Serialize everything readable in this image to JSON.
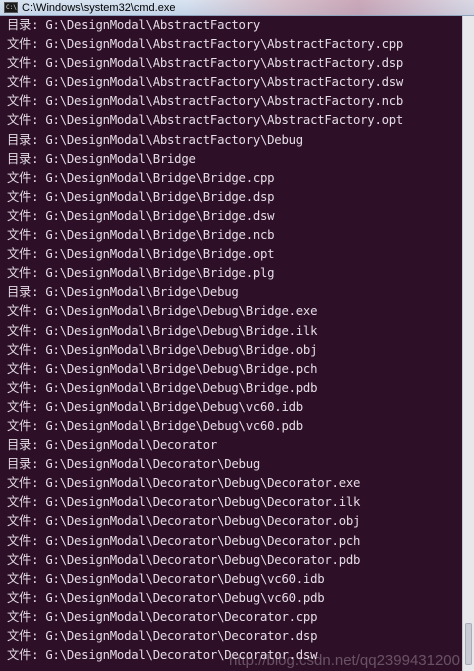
{
  "window": {
    "title": "C:\\Windows\\system32\\cmd.exe",
    "icon_name": "cmd-console-icon"
  },
  "console": {
    "background": "#2e0f28",
    "foreground": "#e4dce4",
    "lines": [
      "目录: G:\\DesignModal\\AbstractFactory",
      "文件: G:\\DesignModal\\AbstractFactory\\AbstractFactory.cpp",
      "文件: G:\\DesignModal\\AbstractFactory\\AbstractFactory.dsp",
      "文件: G:\\DesignModal\\AbstractFactory\\AbstractFactory.dsw",
      "文件: G:\\DesignModal\\AbstractFactory\\AbstractFactory.ncb",
      "文件: G:\\DesignModal\\AbstractFactory\\AbstractFactory.opt",
      "目录: G:\\DesignModal\\AbstractFactory\\Debug",
      "目录: G:\\DesignModal\\Bridge",
      "文件: G:\\DesignModal\\Bridge\\Bridge.cpp",
      "文件: G:\\DesignModal\\Bridge\\Bridge.dsp",
      "文件: G:\\DesignModal\\Bridge\\Bridge.dsw",
      "文件: G:\\DesignModal\\Bridge\\Bridge.ncb",
      "文件: G:\\DesignModal\\Bridge\\Bridge.opt",
      "文件: G:\\DesignModal\\Bridge\\Bridge.plg",
      "目录: G:\\DesignModal\\Bridge\\Debug",
      "文件: G:\\DesignModal\\Bridge\\Debug\\Bridge.exe",
      "文件: G:\\DesignModal\\Bridge\\Debug\\Bridge.ilk",
      "文件: G:\\DesignModal\\Bridge\\Debug\\Bridge.obj",
      "文件: G:\\DesignModal\\Bridge\\Debug\\Bridge.pch",
      "文件: G:\\DesignModal\\Bridge\\Debug\\Bridge.pdb",
      "文件: G:\\DesignModal\\Bridge\\Debug\\vc60.idb",
      "文件: G:\\DesignModal\\Bridge\\Debug\\vc60.pdb",
      "目录: G:\\DesignModal\\Decorator",
      "目录: G:\\DesignModal\\Decorator\\Debug",
      "文件: G:\\DesignModal\\Decorator\\Debug\\Decorator.exe",
      "文件: G:\\DesignModal\\Decorator\\Debug\\Decorator.ilk",
      "文件: G:\\DesignModal\\Decorator\\Debug\\Decorator.obj",
      "文件: G:\\DesignModal\\Decorator\\Debug\\Decorator.pch",
      "文件: G:\\DesignModal\\Decorator\\Debug\\Decorator.pdb",
      "文件: G:\\DesignModal\\Decorator\\Debug\\vc60.idb",
      "文件: G:\\DesignModal\\Decorator\\Debug\\vc60.pdb",
      "文件: G:\\DesignModal\\Decorator\\Decorator.cpp",
      "文件: G:\\DesignModal\\Decorator\\Decorator.dsp",
      "文件: G:\\DesignModal\\Decorator\\Decorator.dsw"
    ]
  },
  "watermark": {
    "text": "http://blog.csdn.net/qq2399431200"
  }
}
